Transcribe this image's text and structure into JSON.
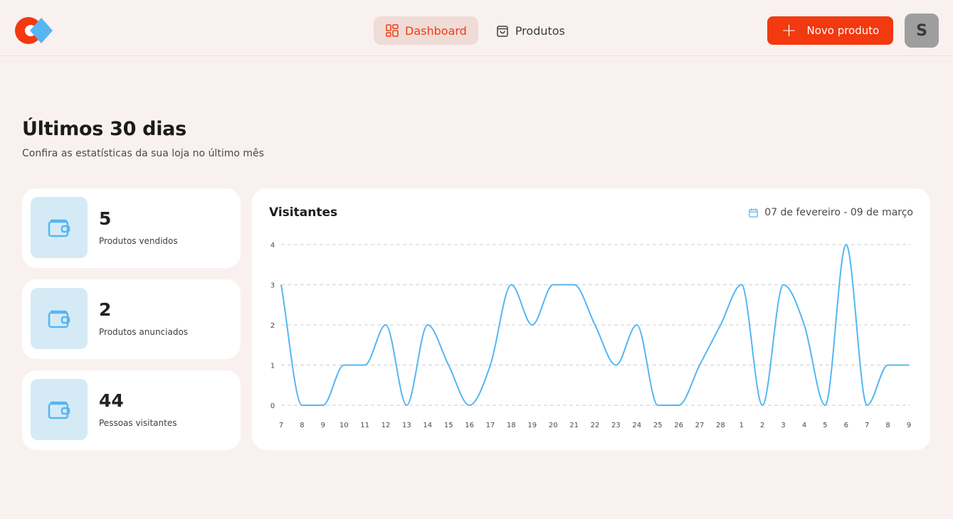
{
  "header": {
    "nav": [
      {
        "label": "Dashboard",
        "active": true,
        "icon": "dashboard-icon"
      },
      {
        "label": "Produtos",
        "active": false,
        "icon": "shopping-bag-icon"
      }
    ],
    "new_product_label": "Novo produto",
    "avatar_initial": "S"
  },
  "page": {
    "title": "Últimos 30 dias",
    "subtitle": "Confira as estatísticas da sua loja no último mês"
  },
  "stats": [
    {
      "value": "5",
      "label": "Produtos vendidos",
      "icon": "wallet-icon"
    },
    {
      "value": "2",
      "label": "Produtos anunciados",
      "icon": "wallet-icon"
    },
    {
      "value": "44",
      "label": "Pessoas visitantes",
      "icon": "wallet-icon"
    }
  ],
  "chart": {
    "title": "Visitantes",
    "range": "07 de fevereiro - 09 de março"
  },
  "colors": {
    "accent": "#f2390f",
    "line": "#55b6f2",
    "icon_bg": "#d4ebf6",
    "background": "#f9f1ef"
  },
  "chart_data": {
    "type": "line",
    "title": "Visitantes",
    "categories": [
      "7",
      "8",
      "9",
      "10",
      "11",
      "12",
      "13",
      "14",
      "15",
      "16",
      "17",
      "18",
      "19",
      "20",
      "21",
      "22",
      "23",
      "24",
      "25",
      "26",
      "27",
      "28",
      "1",
      "2",
      "3",
      "4",
      "5",
      "6",
      "7",
      "8",
      "9"
    ],
    "values": [
      3,
      0,
      0,
      1,
      1,
      2,
      0,
      2,
      1,
      0,
      1,
      3,
      2,
      3,
      3,
      2,
      1,
      2,
      0,
      0,
      1,
      2,
      3,
      0,
      3,
      2,
      0,
      4,
      0,
      1,
      1
    ],
    "ylim": [
      0,
      4
    ],
    "yticks": [
      "0",
      "1",
      "2",
      "3",
      "4"
    ],
    "grid": true,
    "xlabel": "",
    "ylabel": ""
  }
}
